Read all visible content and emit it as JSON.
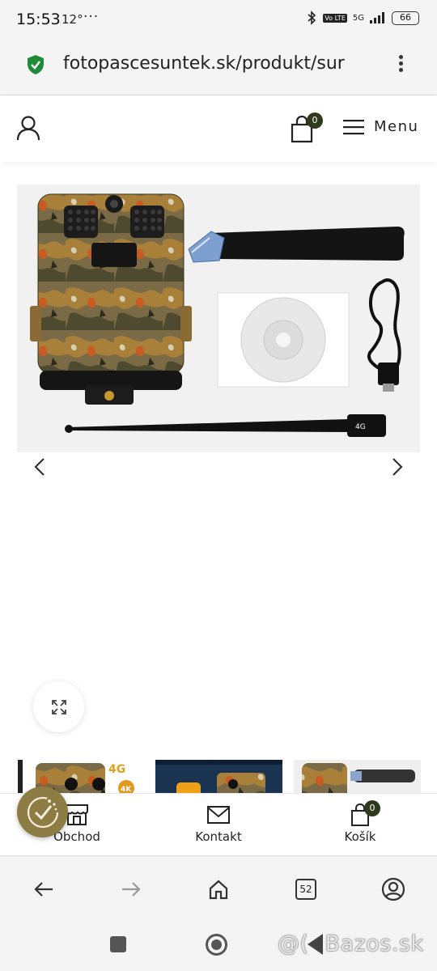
{
  "status_bar": {
    "time": "15:53",
    "temperature": "12°",
    "more": "···",
    "network_volte": "Vo LTE",
    "network_type": "5G",
    "battery": "66"
  },
  "browser": {
    "url": "fotopascesuntek.sk/produkt/sur",
    "tab_count": "52"
  },
  "header": {
    "cart_count": "0",
    "menu_label": "Menu"
  },
  "product": {
    "antenna_label": "4G"
  },
  "thumbnails": {
    "thumb1_badge": "4G",
    "thumb1_sub": "4K"
  },
  "bottom_nav": {
    "shop_label": "Obchod",
    "contact_label": "Kontakt",
    "cart_label": "Košík",
    "cart_count": "0"
  },
  "watermark": {
    "text": "Bazos.sk",
    "prefix": "@("
  },
  "colors": {
    "badge": "#2e3a1c",
    "eco_badge": "#8d7d45",
    "secure": "#1f8a3a",
    "background": "#f4f4f4"
  }
}
